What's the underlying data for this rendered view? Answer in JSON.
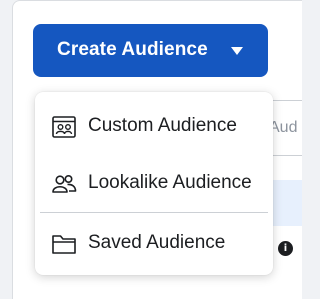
{
  "background": {
    "field_text": "Aud",
    "info_icon": "info-icon",
    "info_glyph": "i"
  },
  "create_button": {
    "label": "Create Audience",
    "icon": "caret-down-icon",
    "color": "#1557c0"
  },
  "menu": {
    "items": [
      {
        "label": "Custom Audience",
        "icon": "custom-audience-icon"
      },
      {
        "label": "Lookalike Audience",
        "icon": "people-icon"
      },
      {
        "label": "Saved Audience",
        "icon": "folder-icon"
      }
    ]
  }
}
